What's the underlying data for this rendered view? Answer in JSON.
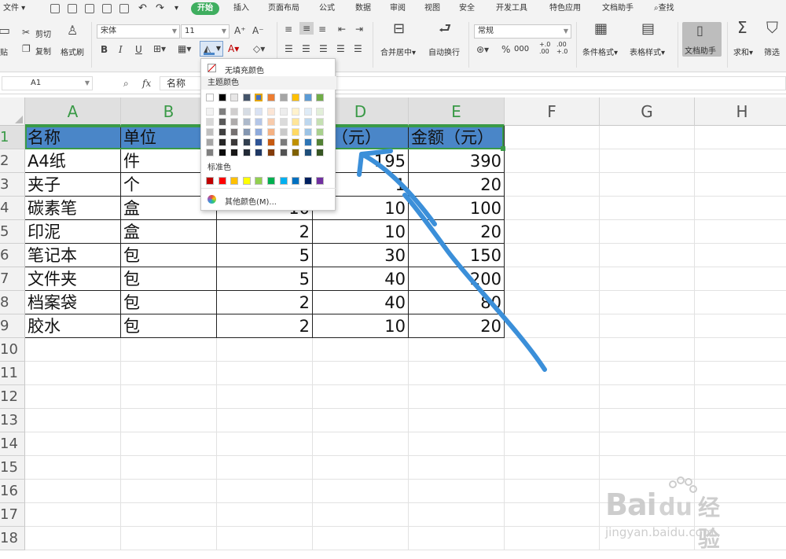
{
  "menu": {
    "file": "文件",
    "tabs": [
      "开始",
      "插入",
      "页面布局",
      "公式",
      "数据",
      "审阅",
      "视图",
      "安全",
      "开发工具",
      "特色应用",
      "文档助手"
    ],
    "search": "查找"
  },
  "ribbon": {
    "cut": "剪切",
    "copy": "复制",
    "paste": "贴",
    "format_painter": "格式刷",
    "font_name": "宋体",
    "font_size": "11",
    "merge_center": "合并居中",
    "wrap_text": "自动换行",
    "number_format": "常规",
    "percent": "%",
    "inc_decimal": "+.0 .00",
    "dec_decimal": ".00 +.0",
    "cond_format": "条件格式",
    "table_style": "表格样式",
    "doc_helper": "文档助手",
    "sum": "求和",
    "filter": "筛选"
  },
  "formula": {
    "cell_ref": "A1",
    "fx": "fx",
    "value": "名称"
  },
  "grid": {
    "columns": [
      "A",
      "B",
      "C",
      "D",
      "E",
      "F",
      "G",
      "H"
    ],
    "rows": [
      "1",
      "2",
      "3",
      "4",
      "5",
      "6",
      "7",
      "8",
      "9",
      "10",
      "11",
      "12",
      "13",
      "14",
      "15",
      "16",
      "17",
      "18"
    ],
    "header_row": [
      "名称",
      "单位",
      "",
      "价（元）",
      "金额（元）"
    ],
    "data_rows": [
      [
        "A4纸",
        "件",
        "",
        "195",
        "390"
      ],
      [
        "夹子",
        "个",
        "",
        "1",
        "20"
      ],
      [
        "碳素笔",
        "盒",
        "10",
        "10",
        "100"
      ],
      [
        "印泥",
        "盒",
        "2",
        "10",
        "20"
      ],
      [
        "笔记本",
        "包",
        "5",
        "30",
        "150"
      ],
      [
        "文件夹",
        "包",
        "5",
        "40",
        "200"
      ],
      [
        "档案袋",
        "包",
        "2",
        "40",
        "80"
      ],
      [
        "胶水",
        "包",
        "2",
        "10",
        "20"
      ]
    ]
  },
  "color_popup": {
    "no_fill": "无填充颜色",
    "theme_colors_label": "主题颜色",
    "standard_colors_label": "标准色",
    "more_colors": "其他颜色(M)...",
    "theme_top": [
      "#ffffff",
      "#000000",
      "#e7e6e6",
      "#44546a",
      "#4472c4",
      "#ed7d31",
      "#a5a5a5",
      "#ffc000",
      "#5b9bd5",
      "#70ad47"
    ],
    "theme_shades": [
      [
        "#f2f2f2",
        "#7f7f7f",
        "#d0cece",
        "#d6dce4",
        "#d9e2f3",
        "#fbe5d5",
        "#ededed",
        "#fff2cc",
        "#deebf6",
        "#e2efd9"
      ],
      [
        "#d8d8d8",
        "#595959",
        "#aeabab",
        "#adb9ca",
        "#b4c6e7",
        "#f7cbac",
        "#dbdbdb",
        "#fee599",
        "#bdd7ee",
        "#c5e0b3"
      ],
      [
        "#bfbfbf",
        "#3f3f3f",
        "#757070",
        "#8496b0",
        "#8eaadb",
        "#f4b183",
        "#c9c9c9",
        "#ffd965",
        "#9cc3e5",
        "#a8d08d"
      ],
      [
        "#a5a5a5",
        "#262626",
        "#3a3838",
        "#323f4f",
        "#2f5496",
        "#c55a11",
        "#7b7b7b",
        "#bf9000",
        "#2e75b5",
        "#538135"
      ],
      [
        "#7f7f7f",
        "#0c0c0c",
        "#171616",
        "#222a35",
        "#1f3864",
        "#833c0b",
        "#525252",
        "#7f6000",
        "#1e4e79",
        "#375623"
      ]
    ],
    "standard": [
      "#c00000",
      "#ff0000",
      "#ffc000",
      "#ffff00",
      "#92d050",
      "#00b050",
      "#00b0f0",
      "#0070c0",
      "#002060",
      "#7030a0"
    ]
  },
  "watermark": {
    "brand": "Bai",
    "brand2": "du",
    "brand_cn": "经验",
    "url": "jingyan.baidu.com"
  },
  "colors": {
    "accent_green": "#3fae5f",
    "header_fill": "#4a86c8",
    "annotation": "#3b8fd9"
  }
}
